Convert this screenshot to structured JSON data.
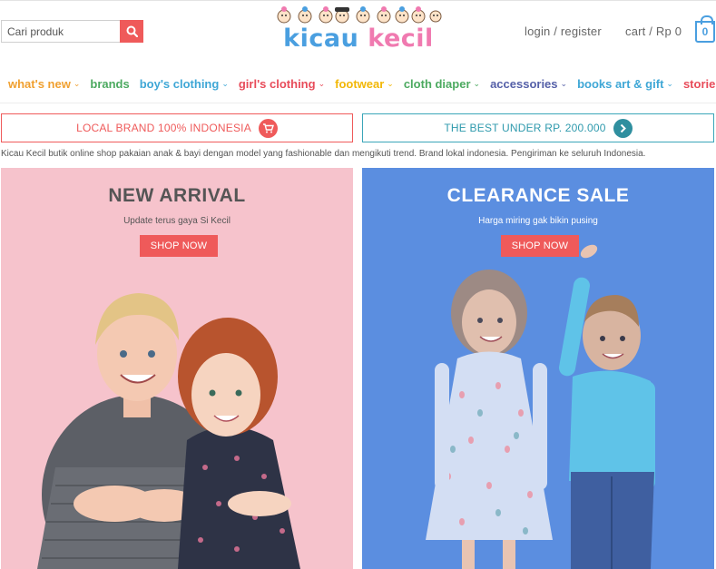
{
  "search": {
    "placeholder": "Cari produk"
  },
  "logo": {
    "word1": "kicau",
    "word2": "kecil"
  },
  "account": {
    "label": "login / register"
  },
  "cart": {
    "label": "cart / Rp 0",
    "count": "0"
  },
  "nav": {
    "items": [
      {
        "label": "what's new",
        "color": "#f0a030",
        "chevron": true
      },
      {
        "label": "brands",
        "color": "#4caa60",
        "chevron": false
      },
      {
        "label": "boy's clothing",
        "color": "#3fa7d6",
        "chevron": true
      },
      {
        "label": "girl's clothing",
        "color": "#e84c5a",
        "chevron": true
      },
      {
        "label": "footwear",
        "color": "#f2b705",
        "chevron": true
      },
      {
        "label": "cloth diaper",
        "color": "#4caa60",
        "chevron": true
      },
      {
        "label": "accessories",
        "color": "#5560a8",
        "chevron": true
      },
      {
        "label": "books art & gift",
        "color": "#3fa7d6",
        "chevron": true
      },
      {
        "label": "stories",
        "color": "#e84c5a",
        "chevron": false
      }
    ]
  },
  "promo": {
    "left": "LOCAL BRAND 100% INDONESIA",
    "right": "THE BEST UNDER RP. 200.000"
  },
  "tagline": "Kicau Kecil butik online shop pakaian anak & bayi dengan model yang fashionable dan mengikuti trend. Brand lokal indonesia. Pengiriman ke seluruh Indonesia.",
  "banners": {
    "new_arrival": {
      "title": "NEW ARRIVAL",
      "subtitle": "Update terus gaya Si Kecil",
      "button": "SHOP NOW"
    },
    "clearance": {
      "title": "CLEARANCE SALE",
      "subtitle": "Harga miring gak bikin pusing",
      "button": "SHOP NOW"
    }
  },
  "colors": {
    "accent_red": "#ef5a5a",
    "accent_teal": "#3aa6b9",
    "logo_blue": "#4a9fe0",
    "logo_pink": "#f07ab0"
  }
}
